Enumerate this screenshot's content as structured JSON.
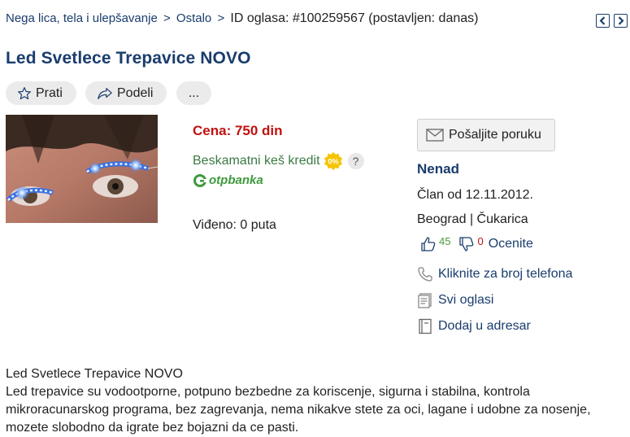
{
  "breadcrumb": {
    "cat1": "Nega lica, tela i ulepšavanje",
    "sep1": ">",
    "cat2": "Ostalo",
    "sep2": ">",
    "ad_id": "ID oglasa: #100259567 (postavljen: danas)"
  },
  "nav": {
    "prev_icon": "chevron-left-icon",
    "next_icon": "chevron-right-icon"
  },
  "title": "Led Svetlece Trepavice NOVO",
  "actions": {
    "follow": "Prati",
    "share": "Podeli",
    "more": "..."
  },
  "listing": {
    "price": "Cena: 750 din",
    "credit_label": "Beskamatni keš kredit",
    "credit_badge": "0%",
    "credit_help": "?",
    "bank_name": "otpbanka",
    "views": "Viđeno: 0 puta"
  },
  "seller": {
    "message_button": "Pošaljite poruku",
    "name": "Nenad",
    "member_since": "Član od 12.11.2012.",
    "location": "Beograd | Čukarica",
    "positive": "45",
    "negative": "0",
    "rate_label": "Ocenite",
    "phone_label": "Kliknite za broj telefona",
    "all_ads_label": "Svi oglasi",
    "address_book_label": "Dodaj u adresar"
  },
  "description": {
    "heading": "Led Svetlece Trepavice NOVO",
    "body": "Led trepavice su vodootporne, potpuno bezbedne za koriscenje, sigurna i stabilna, kontrola mikroracunarskog programa, bez zagrevanja, nema nikakve stete za oci, lagane i udobne za nosenje, mozete slobodno da igrate bez bojazni da ce pasti."
  },
  "colors": {
    "brand": "#1a3d6d",
    "price": "#c0110f",
    "credit": "#3c7a43",
    "badge": "#f5c400"
  }
}
